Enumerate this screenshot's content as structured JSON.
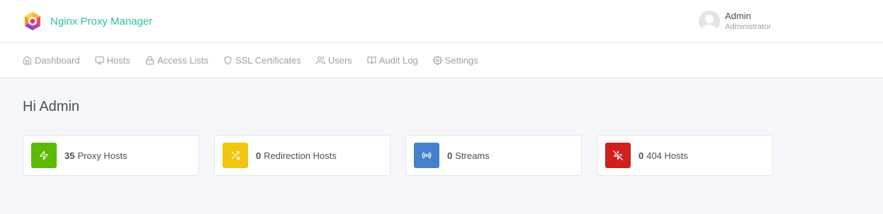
{
  "header": {
    "app_name": "Nginx Proxy Manager",
    "user": {
      "name": "Admin",
      "role": "Administrator"
    }
  },
  "nav": {
    "items": [
      {
        "label": "Dashboard",
        "icon": "home-icon"
      },
      {
        "label": "Hosts",
        "icon": "monitor-icon"
      },
      {
        "label": "Access Lists",
        "icon": "lock-icon"
      },
      {
        "label": "SSL Certificates",
        "icon": "shield-icon"
      },
      {
        "label": "Users",
        "icon": "users-icon"
      },
      {
        "label": "Audit Log",
        "icon": "book-open-icon"
      },
      {
        "label": "Settings",
        "icon": "settings-icon"
      }
    ]
  },
  "main": {
    "greeting": "Hi Admin",
    "cards": [
      {
        "count": "35",
        "label": "Proxy Hosts",
        "icon": "zap-icon",
        "color": "#5eba00"
      },
      {
        "count": "0",
        "label": "Redirection Hosts",
        "icon": "shuffle-icon",
        "color": "#f1c40f"
      },
      {
        "count": "0",
        "label": "Streams",
        "icon": "radio-icon",
        "color": "#467fcf"
      },
      {
        "count": "0",
        "label": "404 Hosts",
        "icon": "zap-off-icon",
        "color": "#cd201f"
      }
    ]
  },
  "colors": {
    "brand": "#2dbfaa",
    "background": "#f5f7fb",
    "nav_text": "#9aa0ac"
  }
}
